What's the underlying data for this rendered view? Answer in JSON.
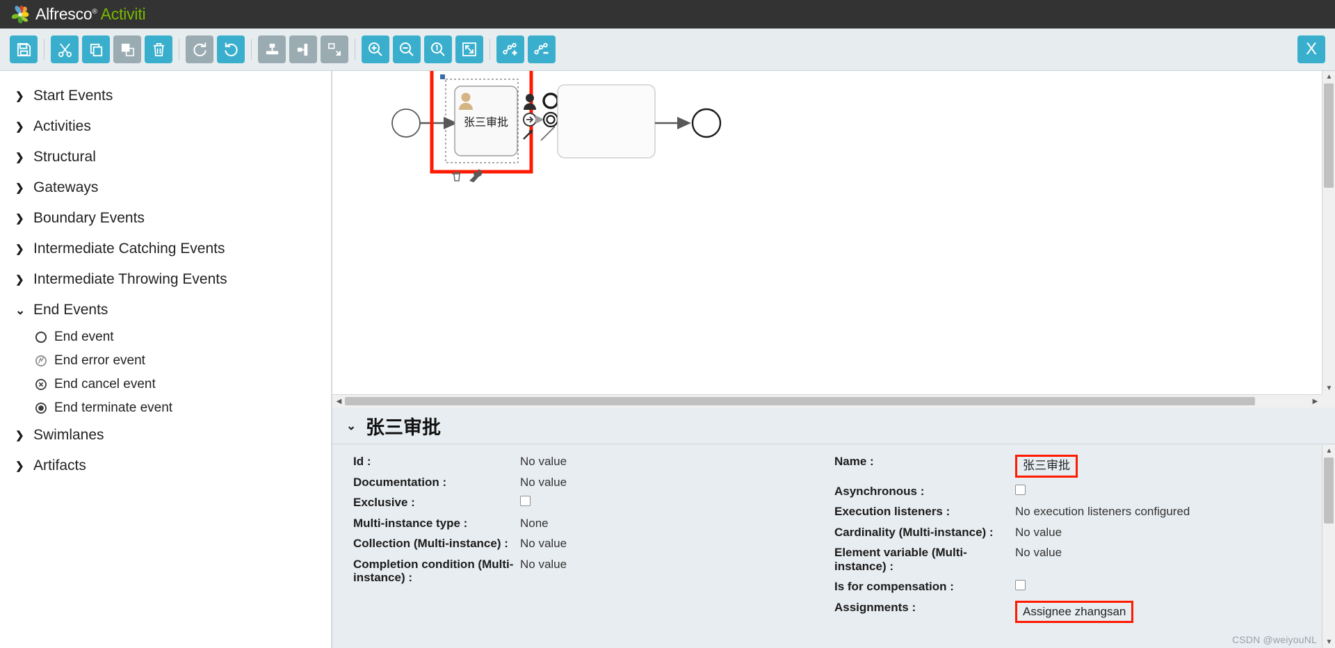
{
  "header": {
    "brand_primary": "Alfresco",
    "brand_registered": "®",
    "brand_secondary": "Activiti",
    "logo_icon": "alfresco-pinwheel-logo",
    "bg_color": "#333333",
    "accent_color": "#7ab800"
  },
  "toolbar": {
    "accent_enabled": "#3aafcd",
    "accent_disabled": "#9aacb2",
    "buttons": [
      {
        "name": "save-button",
        "icon": "floppy-disk-icon",
        "enabled": true
      },
      {
        "name": "cut-button",
        "icon": "scissors-icon",
        "enabled": true
      },
      {
        "name": "copy-button",
        "icon": "copy-icon",
        "enabled": true
      },
      {
        "name": "paste-button",
        "icon": "paste-icon",
        "enabled": false
      },
      {
        "name": "delete-button",
        "icon": "trash-icon",
        "enabled": true
      },
      {
        "name": "redo-button",
        "icon": "redo-arrow-icon",
        "enabled": false
      },
      {
        "name": "undo-button",
        "icon": "undo-arrow-icon",
        "enabled": true
      },
      {
        "name": "align-vertical-button",
        "icon": "align-vertical-icon",
        "enabled": false
      },
      {
        "name": "align-horizontal-button",
        "icon": "align-horizontal-icon",
        "enabled": false
      },
      {
        "name": "same-size-button",
        "icon": "same-size-icon",
        "enabled": false
      },
      {
        "name": "zoom-in-button",
        "icon": "magnifier-plus-icon",
        "enabled": true
      },
      {
        "name": "zoom-out-button",
        "icon": "magnifier-minus-icon",
        "enabled": true
      },
      {
        "name": "zoom-actual-button",
        "icon": "magnifier-one-icon",
        "enabled": true
      },
      {
        "name": "zoom-fit-button",
        "icon": "zoom-fit-icon",
        "enabled": true
      },
      {
        "name": "add-bendpoint-button",
        "icon": "bendpoint-add-icon",
        "enabled": true
      },
      {
        "name": "remove-bendpoint-button",
        "icon": "bendpoint-remove-icon",
        "enabled": true
      }
    ],
    "close_label": "X"
  },
  "palette": {
    "groups": [
      {
        "label": "Start Events",
        "expanded": false,
        "items": []
      },
      {
        "label": "Activities",
        "expanded": false,
        "items": []
      },
      {
        "label": "Structural",
        "expanded": false,
        "items": []
      },
      {
        "label": "Gateways",
        "expanded": false,
        "items": []
      },
      {
        "label": "Boundary Events",
        "expanded": false,
        "items": []
      },
      {
        "label": "Intermediate Catching Events",
        "expanded": false,
        "items": []
      },
      {
        "label": "Intermediate Throwing Events",
        "expanded": false,
        "items": []
      },
      {
        "label": "End Events",
        "expanded": true,
        "items": [
          {
            "label": "End event",
            "icon": "end-event-circle-icon"
          },
          {
            "label": "End error event",
            "icon": "end-error-event-icon"
          },
          {
            "label": "End cancel event",
            "icon": "end-cancel-event-icon"
          },
          {
            "label": "End terminate event",
            "icon": "end-terminate-event-icon"
          }
        ]
      },
      {
        "label": "Swimlanes",
        "expanded": false,
        "items": []
      },
      {
        "label": "Artifacts",
        "expanded": false,
        "items": []
      }
    ],
    "caret_collapsed": "❯",
    "caret_expanded": "⌄"
  },
  "canvas": {
    "selected_shape_label": "张三审批",
    "selection_highlight_color": "#ff1a00",
    "start_event_name": "start-event-circle",
    "end_event_name": "end-event-circle",
    "quick_menu_icons": [
      "user-task-icon",
      "end-event-icon",
      "gateway-icon",
      "throw-event-icon",
      "terminate-event-icon",
      "sequence-flow-icon",
      "boundary-event-icon"
    ]
  },
  "properties": {
    "title": "张三审批",
    "left": [
      {
        "label": "Id :",
        "value": "No value",
        "type": "text"
      },
      {
        "label": "Documentation :",
        "value": "No value",
        "type": "text"
      },
      {
        "label": "Exclusive :",
        "value": "",
        "type": "checkbox",
        "checked": false
      },
      {
        "label": "Multi-instance type :",
        "value": "None",
        "type": "text"
      },
      {
        "label": "Collection (Multi-instance) :",
        "value": "No value",
        "type": "text"
      },
      {
        "label": "Completion condition (Multi-instance) :",
        "value": "No value",
        "type": "text"
      }
    ],
    "right": [
      {
        "label": "Name :",
        "value": "张三审批",
        "type": "highlight"
      },
      {
        "label": "Asynchronous :",
        "value": "",
        "type": "checkbox",
        "checked": false
      },
      {
        "label": "Execution listeners :",
        "value": "No execution listeners configured",
        "type": "text"
      },
      {
        "label": "Cardinality (Multi-instance) :",
        "value": "No value",
        "type": "text"
      },
      {
        "label": "Element variable (Multi-instance) :",
        "value": "No value",
        "type": "text"
      },
      {
        "label": "Is for compensation :",
        "value": "",
        "type": "checkbox",
        "checked": false
      },
      {
        "label": "Assignments :",
        "value": "Assignee zhangsan",
        "type": "highlight"
      }
    ],
    "highlight_color": "#ff1a00"
  },
  "watermark": {
    "text": "CSDN @weiyouNL"
  }
}
